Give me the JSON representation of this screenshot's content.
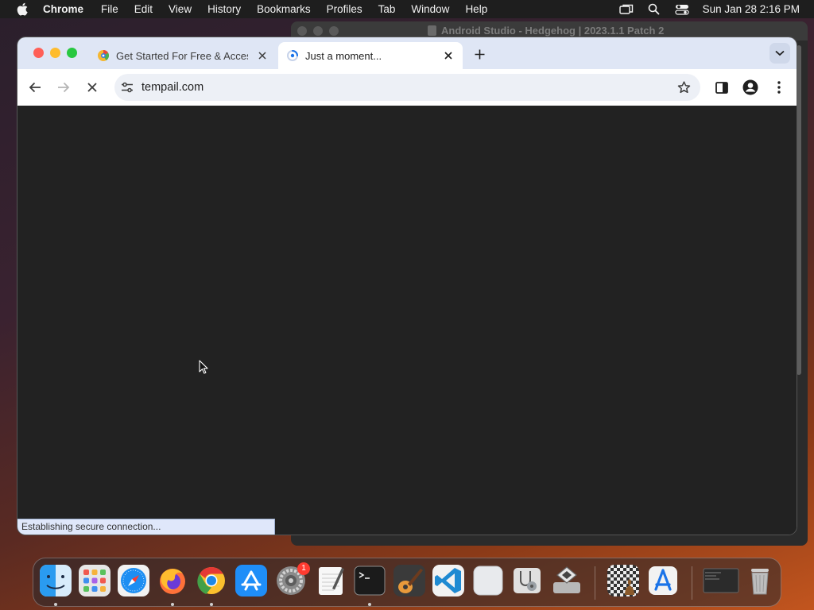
{
  "menubar": {
    "app_name": "Chrome",
    "items": [
      "File",
      "Edit",
      "View",
      "History",
      "Bookmarks",
      "Profiles",
      "Tab",
      "Window",
      "Help"
    ],
    "clock": "Sun Jan 28  2:16 PM"
  },
  "background_window": {
    "title": "Android Studio - Hedgehog | 2023.1.1 Patch 2"
  },
  "chrome": {
    "tabs": [
      {
        "title": "Get Started For Free & Access",
        "favicon": "chromatic-favicon",
        "active": false
      },
      {
        "title": "Just a moment...",
        "favicon": "loading-spinner-favicon",
        "active": true
      }
    ],
    "address_bar": {
      "url": "tempail.com"
    },
    "status_text": "Establishing secure connection..."
  },
  "dock": {
    "apps": [
      "Finder",
      "Launchpad",
      "Safari",
      "Firefox",
      "Google Chrome",
      "App Store",
      "System Settings",
      "TextEdit",
      "Terminal",
      "GarageBand",
      "Visual Studio Code",
      "Preview",
      "Disk Utility",
      "Boot Camp Assistant",
      "Chess",
      "Xcode Instruments",
      "Screen",
      "Trash"
    ],
    "settings_badge": "1"
  },
  "colors": {
    "close": "#ff5f57",
    "minimize": "#febc2e",
    "zoom": "#28c840",
    "tabstrip": "#dfe6f5",
    "page_bg": "#222222"
  }
}
